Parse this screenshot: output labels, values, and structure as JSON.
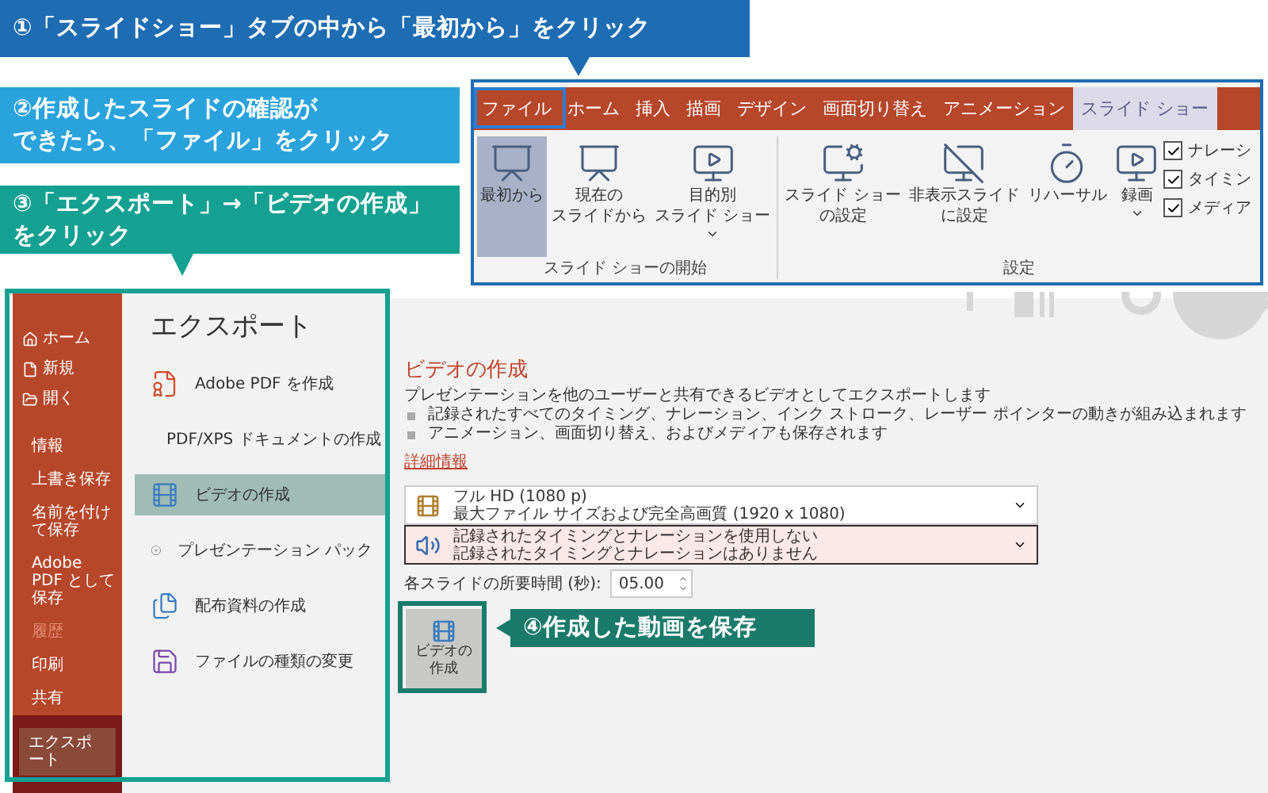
{
  "callouts": [
    {
      "kind": "step1",
      "lines": [
        "①「スライドショー」タブの中から「最初から」をクリック"
      ]
    },
    {
      "kind": "step2",
      "lines": [
        "②作成したスライドの確認が",
        "できたら、「ファイル」をクリック"
      ]
    },
    {
      "kind": "step3",
      "lines": [
        "③「エクスポート」→「ビデオの作成」",
        "をクリック"
      ]
    },
    {
      "kind": "step4",
      "lines": [
        "④作成した動画を保存"
      ]
    }
  ],
  "ribbon": {
    "tabs": [
      {
        "label": "ファイル",
        "selected": false
      },
      {
        "label": "ホーム",
        "selected": false
      },
      {
        "label": "挿入",
        "selected": false
      },
      {
        "label": "描画",
        "selected": false
      },
      {
        "label": "デザイン",
        "selected": false
      },
      {
        "label": "画面切り替え",
        "selected": false
      },
      {
        "label": "アニメーション",
        "selected": false
      },
      {
        "label": "スライド ショー",
        "selected": true
      }
    ],
    "groups": [
      {
        "label": "スライド ショーの開始",
        "buttons": [
          {
            "lines": [
              "最初から"
            ],
            "selected": true,
            "menu": false
          },
          {
            "lines": [
              "現在の",
              "スライドから"
            ],
            "selected": false,
            "menu": false
          },
          {
            "lines": [
              "目的別",
              "スライド ショー"
            ],
            "selected": false,
            "menu": true
          }
        ]
      },
      {
        "label": "設定",
        "buttons": [
          {
            "lines": [
              "スライド ショー",
              "の設定"
            ],
            "selected": false,
            "menu": false
          },
          {
            "lines": [
              "非表示スライド",
              "に設定"
            ],
            "selected": false,
            "menu": false
          },
          {
            "lines": [
              "リハーサル"
            ],
            "selected": false,
            "menu": false
          },
          {
            "lines": [
              "録画"
            ],
            "selected": false,
            "menu": true
          }
        ],
        "checkboxes": [
          {
            "label": "ナレーシ",
            "checked": true
          },
          {
            "label": "タイミン",
            "checked": true
          },
          {
            "label": "メディア",
            "checked": true
          }
        ]
      }
    ]
  },
  "backstage": {
    "sidebar": [
      {
        "label": "ホーム",
        "kind": "nav",
        "selected": false,
        "disabled": false
      },
      {
        "label": "新規",
        "kind": "nav",
        "selected": false,
        "disabled": false
      },
      {
        "label": "開く",
        "kind": "nav",
        "selected": false,
        "disabled": false
      },
      {
        "label": "情報",
        "kind": "page",
        "selected": false,
        "disabled": false
      },
      {
        "label": "上書き保存",
        "kind": "page",
        "selected": false,
        "disabled": false
      },
      {
        "label": "名前を付けて保存",
        "kind": "page",
        "selected": false,
        "disabled": false
      },
      {
        "label": "Adobe PDF として保存",
        "kind": "page",
        "selected": false,
        "disabled": false
      },
      {
        "label": "履歴",
        "kind": "page",
        "selected": false,
        "disabled": true
      },
      {
        "label": "印刷",
        "kind": "page",
        "selected": false,
        "disabled": false
      },
      {
        "label": "共有",
        "kind": "page",
        "selected": false,
        "disabled": false
      },
      {
        "label": "エクスポート",
        "kind": "page",
        "selected": true,
        "disabled": false
      }
    ],
    "export": {
      "title": "エクスポート",
      "options": [
        {
          "label": "Adobe PDF を作成",
          "selected": false
        },
        {
          "label": "PDF/XPS ドキュメントの作成",
          "selected": false
        },
        {
          "label": "ビデオの作成",
          "selected": true
        },
        {
          "label": "プレゼンテーション パック",
          "selected": false
        },
        {
          "label": "配布資料の作成",
          "selected": false
        },
        {
          "label": "ファイルの種類の変更",
          "selected": false
        }
      ]
    },
    "video": {
      "title": "ビデオの作成",
      "description": "プレゼンテーションを他のユーザーと共有できるビデオとしてエクスポートします",
      "bullets": [
        "記録されたすべてのタイミング、ナレーション、インク ストローク、レーザー ポインターの動きが組み込まれます",
        "アニメーション、画面切り替え、およびメディアも保存されます"
      ],
      "link": "詳細情報",
      "quality": {
        "title": "フル HD (1080 p)",
        "subtitle": "最大ファイル サイズおよび完全高画質 (1920 x 1080)"
      },
      "narration": {
        "title": "記録されたタイミングとナレーションを使用しない",
        "subtitle": "記録されたタイミングとナレーションはありません"
      },
      "seconds": {
        "label": "各スライドの所要時間 (秒):",
        "value": "05.00"
      },
      "create_button": [
        "ビデオの",
        "作成"
      ]
    }
  }
}
